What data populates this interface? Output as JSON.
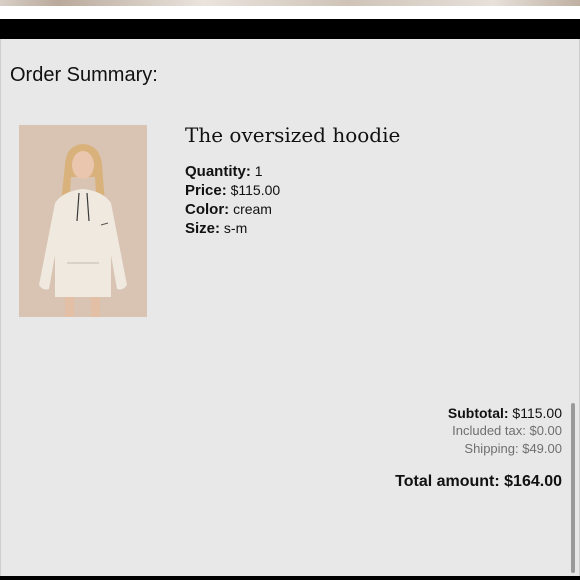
{
  "page": {
    "title": "Order Summary:"
  },
  "product": {
    "name": "The oversized hoodie",
    "image_icon": "hoodie-photo",
    "details": [
      {
        "label": "Quantity:",
        "value": "1"
      },
      {
        "label": "Price:",
        "value": "$115.00"
      },
      {
        "label": "Color:",
        "value": "cream"
      },
      {
        "label": "Size:",
        "value": "s-m"
      }
    ]
  },
  "totals": {
    "subtotal_label": "Subtotal:",
    "subtotal_value": "$115.00",
    "tax_text": "Included tax: $0.00",
    "shipping_text": "Shipping: $49.00",
    "total_label": "Total amount:",
    "total_value": "$164.00"
  },
  "colors": {
    "panel_background": "#e8e8e8",
    "header_bar": "#000000",
    "muted_text": "#6f6f6f",
    "photo_background": "#d9c3b3"
  }
}
